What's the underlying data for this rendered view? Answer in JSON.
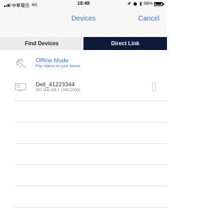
{
  "status_bar": {
    "carrier": "中華電信",
    "network": "4G",
    "time": "18:48",
    "battery_text": "98%",
    "battery_level": 0.98
  },
  "nav": {
    "title": "Devices",
    "cancel_label": "Cancel"
  },
  "tabs": [
    {
      "label": "Find Devices",
      "selected": true
    },
    {
      "label": "Direct Link",
      "selected": false
    }
  ],
  "offline_mode": {
    "title": "Offline Mode",
    "subtitle": "Play videos on your device",
    "icon": "offline-icon"
  },
  "device": {
    "name": "Dell_41223344",
    "address": "192.168.168.1 (14912000)",
    "icon": "tv-icon",
    "remote_icon": "remote-icon"
  },
  "colors": {
    "accent": "#3d6fd6",
    "tab_active": "#0d1a3a",
    "tab_inactive": "#ececec",
    "bar_bg": "#f7f7f7"
  }
}
